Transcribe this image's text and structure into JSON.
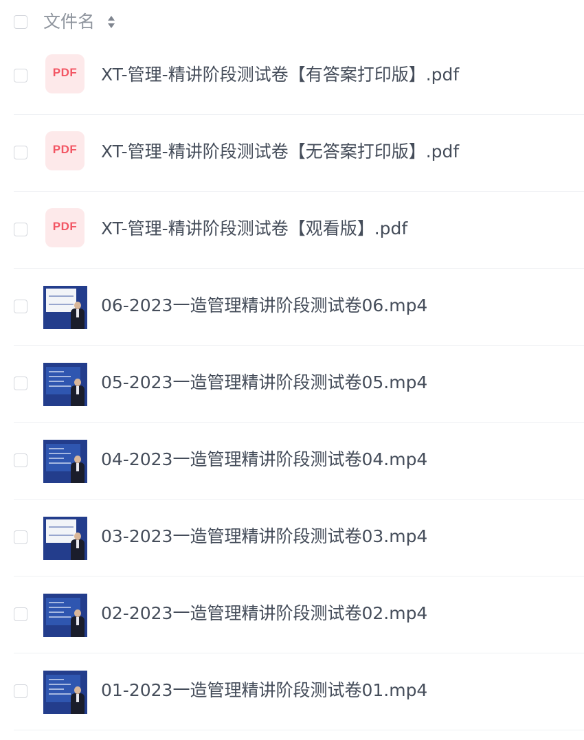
{
  "header": {
    "select_all": false,
    "column_label": "文件名",
    "sort_icon": "sort-icon"
  },
  "files": [
    {
      "name": "XT-管理-精讲阶段测试卷【有答案打印版】.pdf",
      "type": "pdf",
      "icon_label": "PDF",
      "selected": false
    },
    {
      "name": "XT-管理-精讲阶段测试卷【无答案打印版】.pdf",
      "type": "pdf",
      "icon_label": "PDF",
      "selected": false
    },
    {
      "name": "XT-管理-精讲阶段测试卷【观看版】.pdf",
      "type": "pdf",
      "icon_label": "PDF",
      "selected": false
    },
    {
      "name": "06-2023一造管理精讲阶段测试卷06.mp4",
      "type": "video",
      "selected": false
    },
    {
      "name": "05-2023一造管理精讲阶段测试卷05.mp4",
      "type": "video",
      "selected": false
    },
    {
      "name": "04-2023一造管理精讲阶段测试卷04.mp4",
      "type": "video",
      "selected": false
    },
    {
      "name": "03-2023一造管理精讲阶段测试卷03.mp4",
      "type": "video",
      "selected": false
    },
    {
      "name": "02-2023一造管理精讲阶段测试卷02.mp4",
      "type": "video",
      "selected": false
    },
    {
      "name": "01-2023一造管理精讲阶段测试卷01.mp4",
      "type": "video",
      "selected": false
    }
  ],
  "colors": {
    "text": "#454d5a",
    "header_text": "#8f959e",
    "pdf_bg": "#fde9ea",
    "pdf_fg": "#f25563",
    "video_bg": "#233d8c",
    "divider": "#eef0f3"
  }
}
